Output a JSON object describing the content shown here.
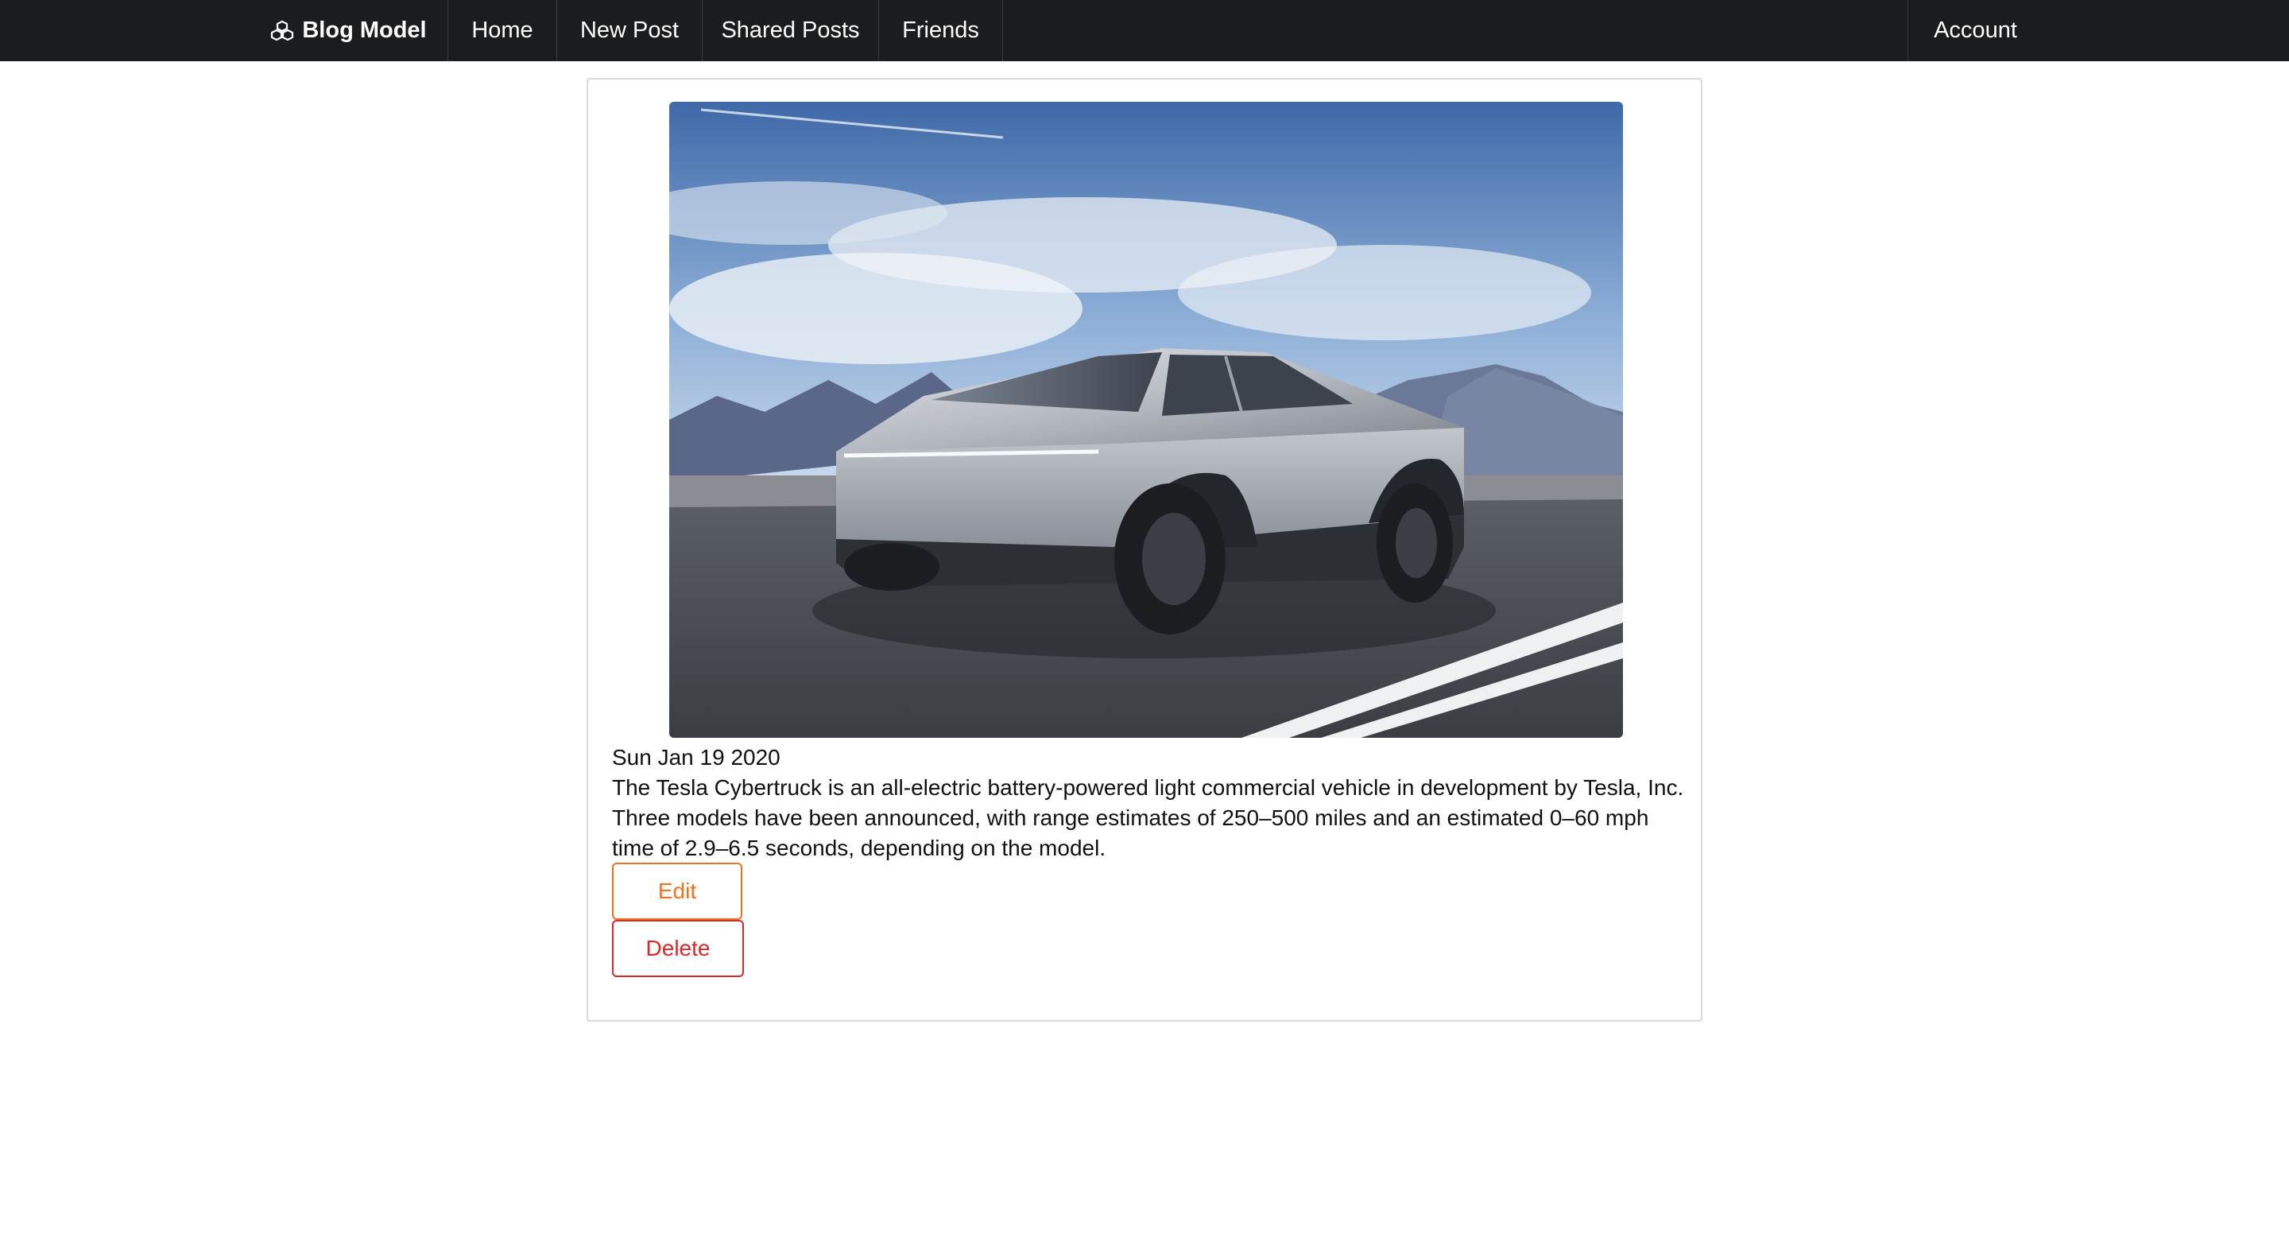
{
  "navbar": {
    "brand": {
      "label": "Blog Model",
      "icon": "cubes-icon"
    },
    "items": [
      {
        "label": "Home"
      },
      {
        "label": "New Post"
      },
      {
        "label": "Shared Posts"
      },
      {
        "label": "Friends"
      }
    ],
    "account": {
      "label": "Account"
    }
  },
  "post": {
    "image_alt": "Tesla Cybertruck",
    "date": "Sun Jan 19 2020",
    "body": "The Tesla Cybertruck is an all-electric battery-powered light commercial vehicle in development by Tesla, Inc. Three models have been announced, with range estimates of 250–500 miles and an estimated 0–60 mph time of 2.9–6.5 seconds, depending on the model.",
    "actions": {
      "edit_label": "Edit",
      "delete_label": "Delete"
    }
  },
  "colors": {
    "navbar_bg": "#1b1c1d",
    "edit": "#f2711c",
    "delete": "#db2828",
    "card_border": "#d9d9d9"
  }
}
